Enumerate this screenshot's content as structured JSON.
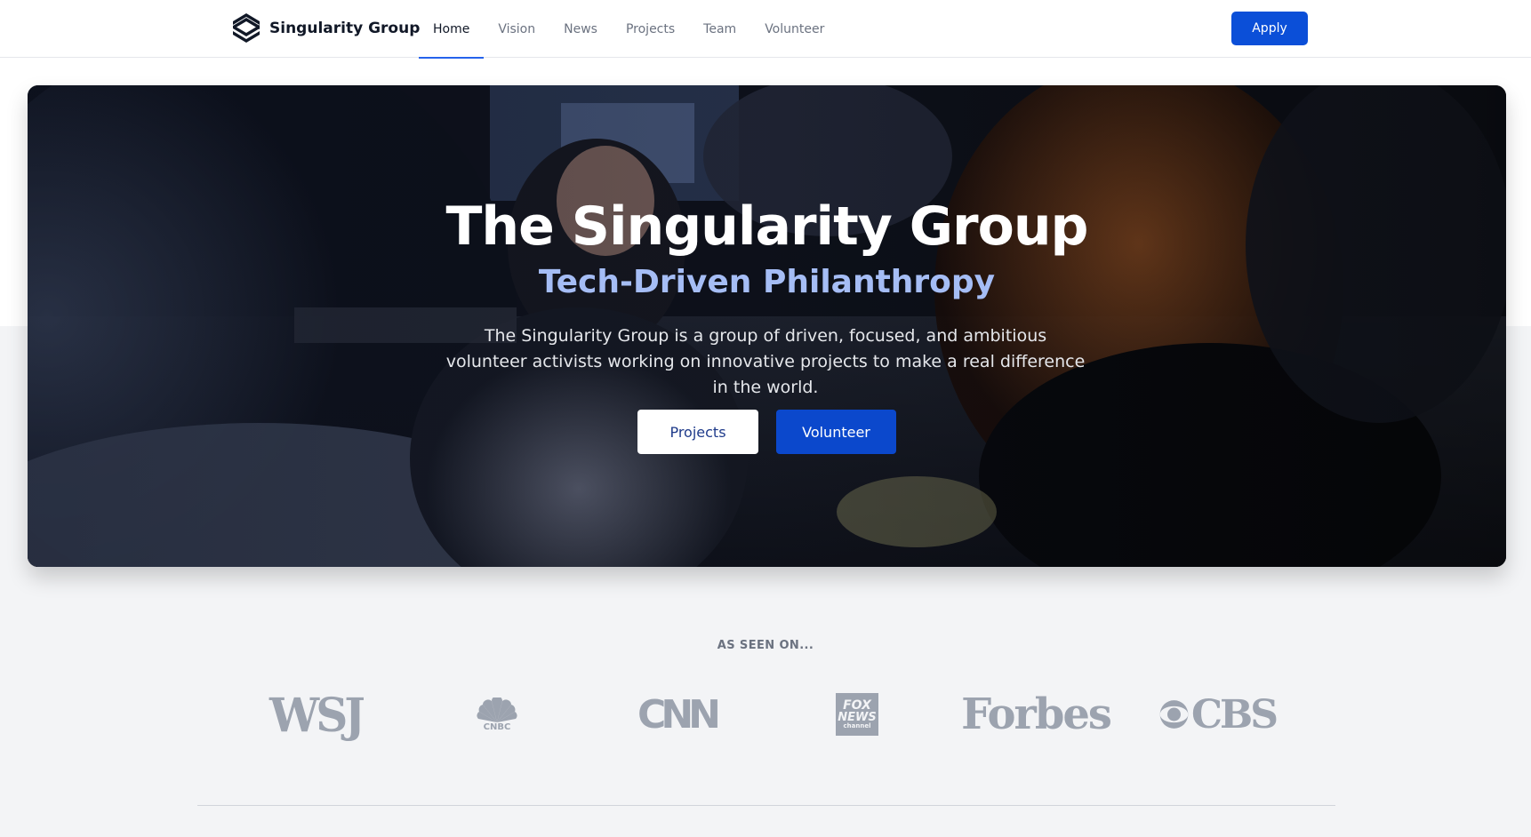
{
  "brand": {
    "name": "Singularity Group",
    "logo_icon": "stacked-chevron-logo-icon"
  },
  "nav": {
    "items": [
      {
        "label": "Home",
        "active": true
      },
      {
        "label": "Vision",
        "active": false
      },
      {
        "label": "News",
        "active": false
      },
      {
        "label": "Projects",
        "active": false
      },
      {
        "label": "Team",
        "active": false
      },
      {
        "label": "Volunteer",
        "active": false
      }
    ],
    "apply_label": "Apply"
  },
  "hero": {
    "title": "The Singularity Group",
    "subtitle": "Tech-Driven Philanthropy",
    "description": "The Singularity Group is a group of driven, focused, and ambitious volunteer activists working on innovative projects to make a real difference in the world.",
    "primary_button": "Projects",
    "secondary_button": "Volunteer",
    "background_image": "people-working-at-laptops-photo"
  },
  "press": {
    "label": "AS SEEN ON...",
    "logos": {
      "wsj": "WSJ",
      "cnbc": "CNBC",
      "cnn": "CNN",
      "fox_line1": "FOX",
      "fox_line2": "NEWS",
      "fox_line3": "channel",
      "forbes": "Forbes",
      "cbs": "CBS"
    }
  },
  "colors": {
    "accent": "#0b4fd8",
    "subtitle": "#a5bdf5",
    "logo_gray": "#9ca3af",
    "page_bg": "#f3f4f6"
  }
}
